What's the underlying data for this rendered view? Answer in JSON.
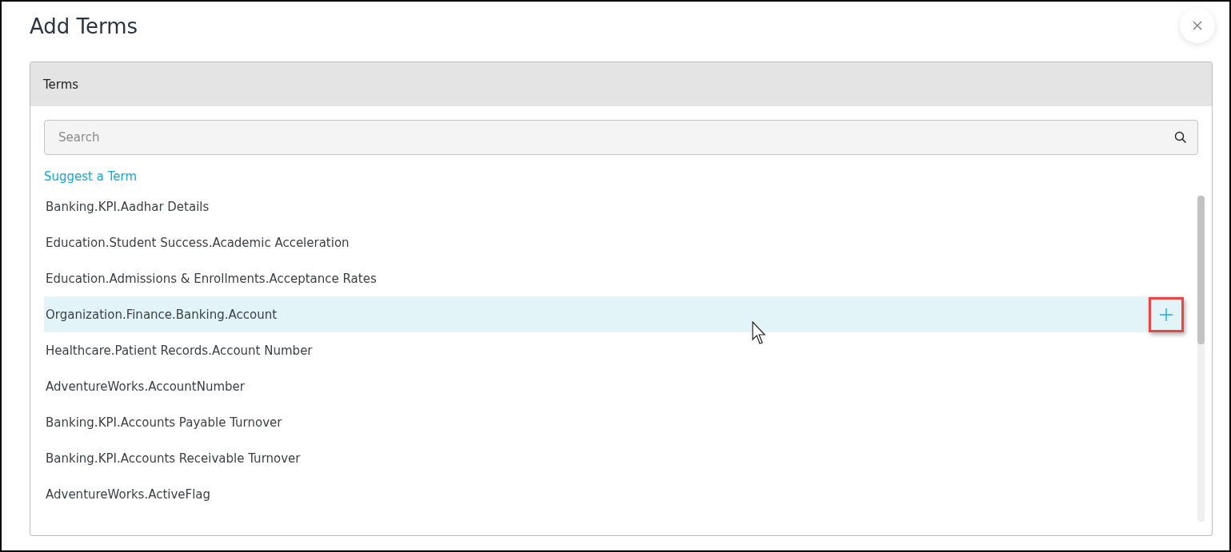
{
  "dialog": {
    "title": "Add Terms"
  },
  "panel": {
    "header": "Terms",
    "search": {
      "placeholder": "Search"
    },
    "suggest_link": "Suggest a Term",
    "add_button": {
      "callout": true
    },
    "terms": [
      {
        "label": "Banking.KPI.Aadhar Details",
        "selected": false
      },
      {
        "label": "Education.Student Success.Academic Acceleration",
        "selected": false
      },
      {
        "label": "Education.Admissions & Enrollments.Acceptance Rates",
        "selected": false
      },
      {
        "label": "Organization.Finance.Banking.Account",
        "selected": true
      },
      {
        "label": "Healthcare.Patient Records.Account Number",
        "selected": false
      },
      {
        "label": "AdventureWorks.AccountNumber",
        "selected": false
      },
      {
        "label": "Banking.KPI.Accounts Payable Turnover",
        "selected": false
      },
      {
        "label": "Banking.KPI.Accounts Receivable Turnover",
        "selected": false
      },
      {
        "label": "AdventureWorks.ActiveFlag",
        "selected": false
      }
    ]
  }
}
